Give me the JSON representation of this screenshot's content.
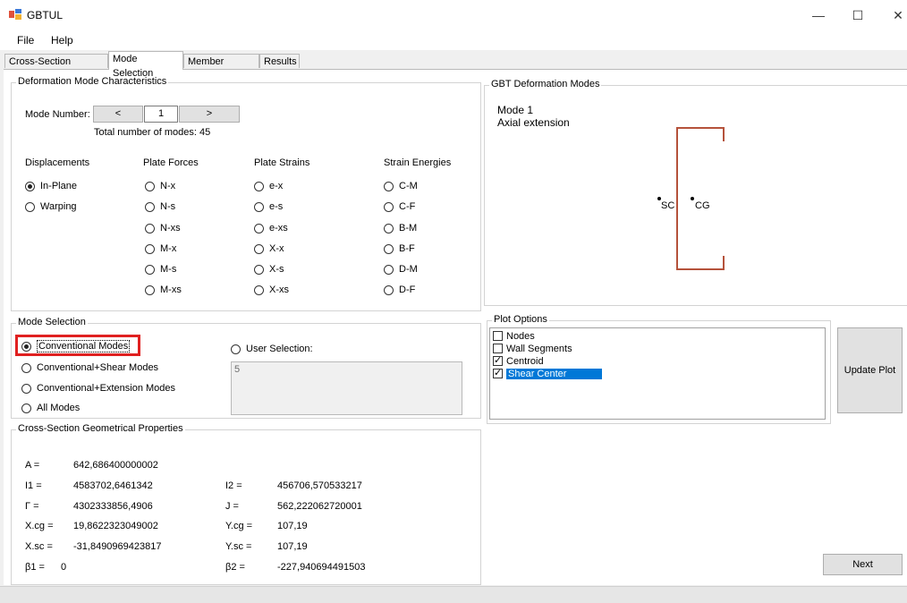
{
  "window": {
    "title": "GBTUL",
    "minimize_glyph": "—",
    "maximize_glyph": "☐",
    "close_glyph": "✕"
  },
  "menu": {
    "items": [
      "File",
      "Help"
    ]
  },
  "tabs": [
    "Cross-Section Analysis",
    "Mode Selection",
    "Member Analysis",
    "Results"
  ],
  "active_tab": "Mode Selection",
  "deformation": {
    "group_title": "Deformation Mode Characteristics",
    "mode_number_label": "Mode Number:",
    "prev_label": "<",
    "next_label": ">",
    "mode_number_value": "1",
    "total_text": "Total number of modes: 45",
    "columns": {
      "displacements": {
        "header": "Displacements",
        "items": [
          "In-Plane",
          "Warping"
        ],
        "selected": 0
      },
      "plate_forces": {
        "header": "Plate Forces",
        "items": [
          "N-x",
          "N-s",
          "N-xs",
          "M-x",
          "M-s",
          "M-xs"
        ]
      },
      "plate_strains": {
        "header": "Plate Strains",
        "items": [
          "e-x",
          "e-s",
          "e-xs",
          "X-x",
          "X-s",
          "X-xs"
        ]
      },
      "strain_energies": {
        "header": "Strain Energies",
        "items": [
          "C-M",
          "C-F",
          "B-M",
          "B-F",
          "D-M",
          "D-F"
        ]
      }
    }
  },
  "gbt_modes": {
    "group_title": "GBT Deformation Modes",
    "mode_title": "Mode 1",
    "mode_desc": "Axial extension",
    "sc_label": "SC",
    "cg_label": "CG",
    "section_color": "#b5523b"
  },
  "mode_selection": {
    "group_title": "Mode Selection",
    "options": [
      "Conventional Modes",
      "Conventional+Shear Modes",
      "Conventional+Extension Modes",
      "All Modes"
    ],
    "selected": 0,
    "user_selection_label": "User Selection:",
    "user_selection_value": "5",
    "highlight_color": "#e02020"
  },
  "plot_options": {
    "group_title": "Plot Options",
    "items": [
      {
        "label": "Nodes",
        "checked": false
      },
      {
        "label": "Wall Segments",
        "checked": false
      },
      {
        "label": "Centroid",
        "checked": true
      },
      {
        "label": "Shear Center",
        "checked": true
      }
    ],
    "selected_index": 3,
    "selected_color": "#0078d7",
    "update_button": "Update Plot"
  },
  "geometry": {
    "group_title": "Cross-Section Geometrical Properties",
    "left": [
      {
        "label": "A =",
        "value": "642,686400000002"
      },
      {
        "label": "I1 =",
        "value": "4583702,6461342"
      },
      {
        "label": "Γ =",
        "value": "4302333856,4906"
      },
      {
        "label": "X.cg =",
        "value": "19,8622323049002"
      },
      {
        "label": "X.sc =",
        "value": "-31,8490969423817"
      },
      {
        "label": "β1 =",
        "value": "0"
      }
    ],
    "right": [
      {
        "label": "I2 =",
        "value": "456706,570533217"
      },
      {
        "label": "J =",
        "value": "562,222062720001"
      },
      {
        "label": "Y.cg =",
        "value": "107,19"
      },
      {
        "label": "Y.sc =",
        "value": "107,19"
      },
      {
        "label": "β2 =",
        "value": "-227,940694491503"
      }
    ]
  },
  "next_button": "Next"
}
